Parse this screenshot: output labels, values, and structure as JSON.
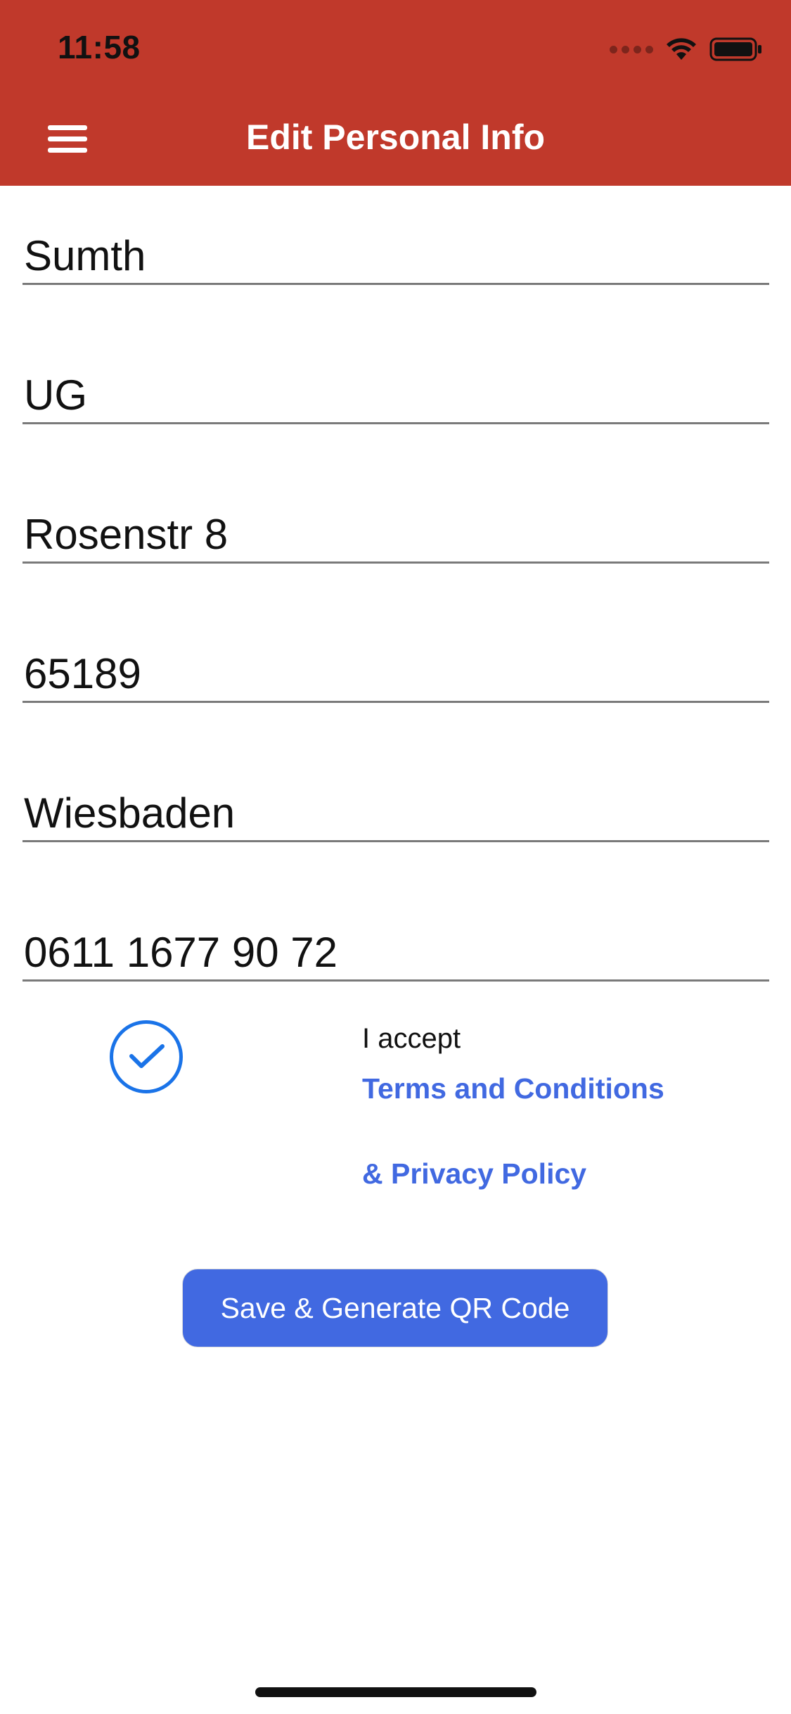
{
  "status_bar": {
    "time": "11:58",
    "icons": [
      "cellular-signal-icon",
      "wifi-icon",
      "battery-icon"
    ]
  },
  "header": {
    "title": "Edit Personal Info",
    "menu_icon": "hamburger-menu-icon",
    "background_color": "#c0392b"
  },
  "form": {
    "fields": [
      {
        "name": "name",
        "value": "Sumth"
      },
      {
        "name": "company",
        "value": "UG"
      },
      {
        "name": "street",
        "value": "Rosenstr 8"
      },
      {
        "name": "postal-code",
        "value": "65189"
      },
      {
        "name": "city",
        "value": "Wiesbaden"
      },
      {
        "name": "phone",
        "value": "0611 1677 90 72"
      }
    ]
  },
  "consent": {
    "checked": true,
    "checkbox_icon": "checkmark-circle-icon",
    "accept_label": "I accept",
    "terms_link": "Terms and Conditions",
    "privacy_link": "& Privacy Policy",
    "link_color": "#4169e1"
  },
  "actions": {
    "save_label": "Save & Generate QR Code",
    "button_color": "#4169e1"
  }
}
